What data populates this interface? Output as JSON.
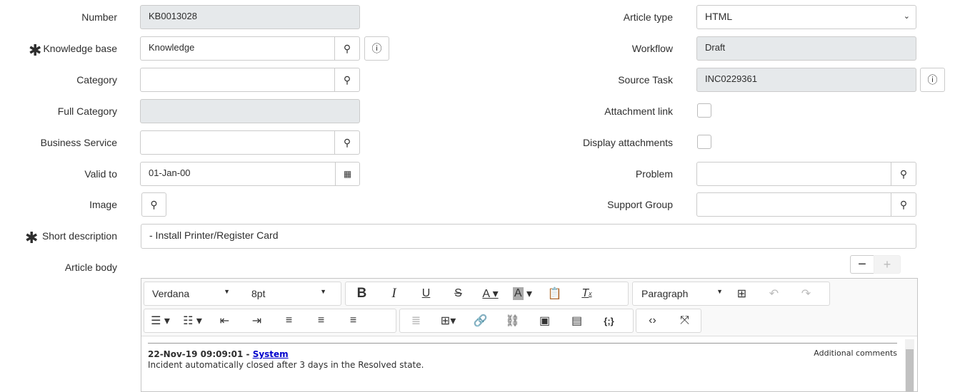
{
  "left": {
    "number": {
      "label": "Number",
      "value": "KB0013028"
    },
    "knowledge_base": {
      "label": "Knowledge base",
      "value": "Knowledge"
    },
    "category": {
      "label": "Category",
      "value": ""
    },
    "full_category": {
      "label": "Full Category",
      "value": ""
    },
    "business_service": {
      "label": "Business Service",
      "value": ""
    },
    "valid_to": {
      "label": "Valid to",
      "value": "01-Jan-00"
    },
    "image": {
      "label": "Image"
    },
    "short_description": {
      "label": "Short description",
      "value": " - Install Printer/Register Card"
    },
    "article_body": {
      "label": "Article body"
    }
  },
  "right": {
    "article_type": {
      "label": "Article type",
      "value": "HTML"
    },
    "workflow": {
      "label": "Workflow",
      "value": "Draft"
    },
    "source_task": {
      "label": "Source Task",
      "value": "INC0229361"
    },
    "attachment_link": {
      "label": "Attachment link",
      "checked": false
    },
    "display_attachments": {
      "label": "Display attachments",
      "checked": false
    },
    "problem": {
      "label": "Problem",
      "value": ""
    },
    "support_group": {
      "label": "Support Group",
      "value": ""
    }
  },
  "required_mark": "✱",
  "editor": {
    "font": "Verdana",
    "size": "8pt",
    "block": "Paragraph",
    "timestamp": "22-Nov-19 09:09:01 - ",
    "author": "System",
    "body": "Incident automatically closed after 3 days in the Resolved state.",
    "tag": "Additional comments"
  }
}
